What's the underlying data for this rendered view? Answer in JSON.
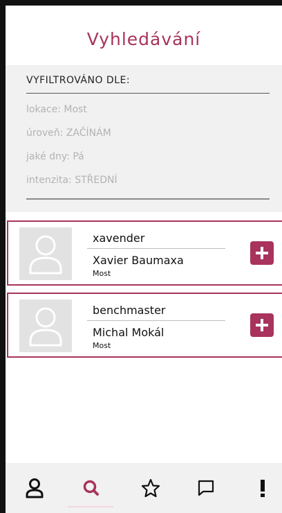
{
  "header": {
    "title": "Vyhledávání"
  },
  "filter": {
    "heading": "VYFILTROVÁNO DLE:",
    "rows": [
      {
        "label": "lokace:",
        "value": "Most"
      },
      {
        "label": "úroveň:",
        "value": "ZAČÍNÁM"
      },
      {
        "label": "jaké dny:",
        "value": "Pá"
      },
      {
        "label": "intenzita:",
        "value": "STŘEDNÍ"
      }
    ]
  },
  "results": [
    {
      "username": "xavender",
      "fullname": "Xavier Baumaxa",
      "city": "Most"
    },
    {
      "username": "benchmaster",
      "fullname": "Michal Mokál",
      "city": "Most"
    }
  ],
  "nav": {
    "items": [
      {
        "name": "profile",
        "icon": "user-icon"
      },
      {
        "name": "search",
        "icon": "search-icon",
        "active": true
      },
      {
        "name": "favorites",
        "icon": "star-icon"
      },
      {
        "name": "messages",
        "icon": "chat-icon"
      },
      {
        "name": "alerts",
        "icon": "exclamation-icon"
      }
    ]
  },
  "colors": {
    "accent": "#a8335c",
    "panel": "#f1f1f1",
    "placeholder": "#e2e2e2"
  }
}
